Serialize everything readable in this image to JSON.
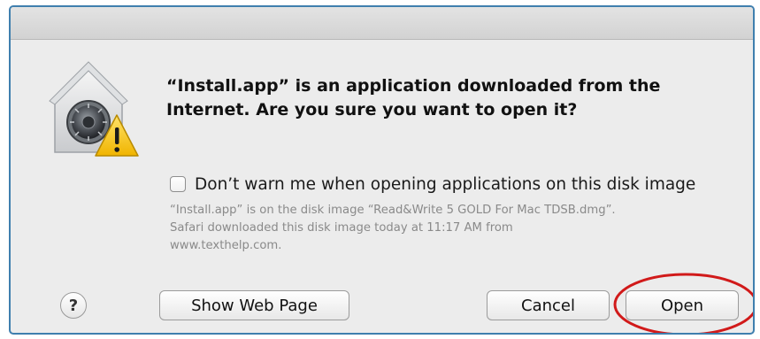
{
  "dialog": {
    "icon": "gatekeeper-lock-warning-icon",
    "message_line1": "“Install.app” is an application downloaded from the",
    "message_line2": "Internet. Are you sure you want to open it?",
    "checkbox": {
      "label": "Don’t warn me when opening applications on this disk image",
      "checked": false
    },
    "info_line1": "“Install.app” is on the disk image “Read&Write 5 GOLD For Mac TDSB.dmg”.",
    "info_line2": "Safari downloaded this disk image today at 11:17 AM from",
    "info_line3": "www.texthelp.com.",
    "help_label": "?",
    "buttons": {
      "show_web_page": "Show Web Page",
      "cancel": "Cancel",
      "open": "Open"
    }
  },
  "colors": {
    "dialog_bg": "#ececec",
    "frame_border": "#3f7fae",
    "highlight_circle": "#d11a1a",
    "warning_yellow": "#f5c400"
  }
}
